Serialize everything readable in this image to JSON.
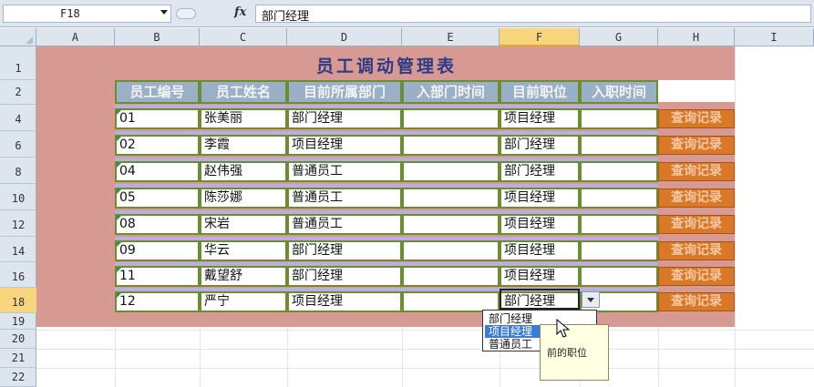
{
  "formula_bar": {
    "name_box": "F18",
    "fx_label": "fx",
    "content": "部门经理"
  },
  "columns": [
    "A",
    "B",
    "C",
    "D",
    "E",
    "F",
    "G",
    "H",
    "I"
  ],
  "rows": [
    "1",
    "2",
    "4",
    "6",
    "8",
    "10",
    "12",
    "14",
    "16",
    "18",
    "19",
    "20",
    "21",
    "22"
  ],
  "title": "员工调动管理表",
  "headers": [
    "员工编号",
    "员工姓名",
    "目前所属部门",
    "入部门时间",
    "目前职位",
    "入职时间"
  ],
  "records": [
    {
      "id": "01",
      "name": "张美丽",
      "dept": "部门经理",
      "dept_time": "",
      "position": "项目经理",
      "join_time": ""
    },
    {
      "id": "02",
      "name": "李霞",
      "dept": "项目经理",
      "dept_time": "",
      "position": "部门经理",
      "join_time": ""
    },
    {
      "id": "04",
      "name": "赵伟强",
      "dept": "普通员工",
      "dept_time": "",
      "position": "部门经理",
      "join_time": ""
    },
    {
      "id": "05",
      "name": "陈莎娜",
      "dept": "普通员工",
      "dept_time": "",
      "position": "项目经理",
      "join_time": ""
    },
    {
      "id": "08",
      "name": "宋岩",
      "dept": "普通员工",
      "dept_time": "",
      "position": "项目经理",
      "join_time": ""
    },
    {
      "id": "09",
      "name": "华云",
      "dept": "部门经理",
      "dept_time": "",
      "position": "项目经理",
      "join_time": ""
    },
    {
      "id": "11",
      "name": "戴望舒",
      "dept": "部门经理",
      "dept_time": "",
      "position": "项目经理",
      "join_time": ""
    },
    {
      "id": "12",
      "name": "严宁",
      "dept": "项目经理",
      "dept_time": "",
      "position": "部门经理",
      "join_time": ""
    }
  ],
  "query_button_label": "查询记录",
  "dropdown_options": [
    "部门经理",
    "项目经理",
    "普通员工"
  ],
  "tooltip": {
    "line1": "前的职位"
  }
}
